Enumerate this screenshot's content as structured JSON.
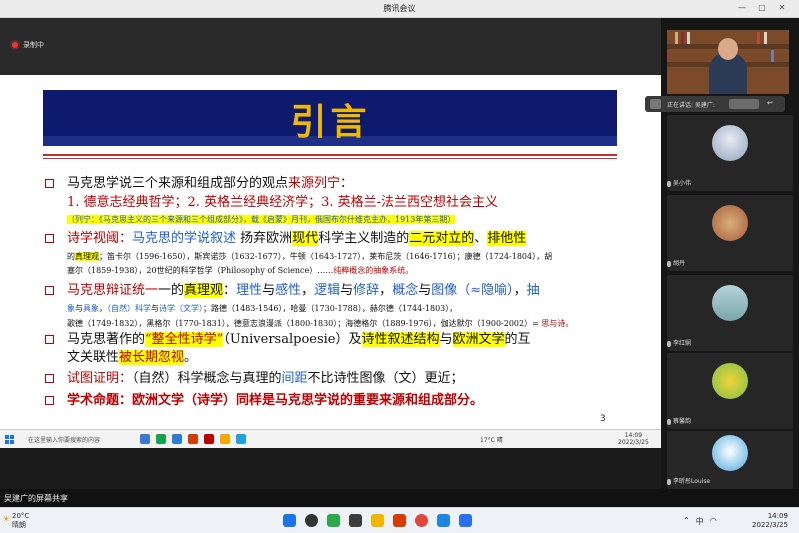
{
  "window": {
    "title": "腾讯会议",
    "controls": [
      "—",
      "▢",
      "✕"
    ]
  },
  "recording": {
    "label": "录制中"
  },
  "slide": {
    "title": "引言",
    "page_number": "3",
    "lines": [
      {
        "parts": [
          {
            "t": "马克思学说三个来源和组成部分的观点"
          },
          {
            "t": "来源列宁",
            "c": "red"
          },
          {
            "t": "："
          }
        ]
      },
      {
        "parts": [
          {
            "t": "1. 德意志经典哲学；2. 英格兰经典经济学；3. 英格兰-法兰西空想社会主义",
            "c": "red"
          }
        ]
      },
      {
        "parts": [
          {
            "t": "（列宁：《马克思主义的三个来源和三个组成部分》，载《启蒙》月刊，俄国布尔什维克主办，1913年第三期）",
            "c": "blue",
            "hl": true
          }
        ]
      },
      {
        "parts": [
          {
            "t": "诗学视阈：",
            "c": "red"
          },
          {
            "t": "马克思的学说叙述",
            "c": "blue"
          },
          {
            "t": " 扬弃欧洲"
          },
          {
            "t": "现代",
            "hl": true
          },
          {
            "t": "科学主义制造的"
          },
          {
            "t": "二元对立的",
            "hl": true
          },
          {
            "t": "、"
          },
          {
            "t": "排他性",
            "hl": true
          }
        ]
      },
      {
        "parts": [
          {
            "t": "的"
          },
          {
            "t": "真理观",
            "hl": true
          },
          {
            "t": "；笛卡尔（1596-1650），斯宾诺莎（1632-1677），牛顿（1643-1727），莱布尼茨（1646-1716）；康德（1724-1804），胡"
          }
        ]
      },
      {
        "parts": [
          {
            "t": "塞尔（1859-1938），20世纪的科学哲学（Philosophy of Science）……"
          },
          {
            "t": "纯粹概念的抽象系统。",
            "c": "red"
          }
        ]
      },
      {
        "parts": [
          {
            "t": "马克思辩证统一",
            "c": "red"
          },
          {
            "t": "一的"
          },
          {
            "t": "真理观",
            "hl": true
          },
          {
            "t": "："
          },
          {
            "t": "理性",
            "c": "blue"
          },
          {
            "t": "与"
          },
          {
            "t": "感性",
            "c": "blue"
          },
          {
            "t": "，"
          },
          {
            "t": "逻辑",
            "c": "blue"
          },
          {
            "t": "与"
          },
          {
            "t": "修辞",
            "c": "blue"
          },
          {
            "t": "，"
          },
          {
            "t": "概念",
            "c": "blue"
          },
          {
            "t": "与"
          },
          {
            "t": "图像（≈隐喻）",
            "c": "blue"
          },
          {
            "t": "，"
          },
          {
            "t": "抽",
            "c": "blue"
          }
        ]
      },
      {
        "parts": [
          {
            "t": "象",
            "c": "blue"
          },
          {
            "t": "与"
          },
          {
            "t": "具象",
            "c": "blue"
          },
          {
            "t": "，"
          },
          {
            "t": "（自然）科学",
            "c": "blue"
          },
          {
            "t": "与"
          },
          {
            "t": "诗学（文学）",
            "c": "blue"
          },
          {
            "t": "；路德（1483-1546），哈曼（1730-1788），赫尔德（1744-1803），"
          }
        ]
      },
      {
        "parts": [
          {
            "t": "歌德（1749-1832），黑格尔（1770-1831），德意志浪漫派（1800-1830）；海德格尔（1889-1976），伽达默尔（1900-2002）= "
          },
          {
            "t": "思与诗。",
            "c": "red"
          }
        ]
      },
      {
        "parts": [
          {
            "t": "马克思著作的"
          },
          {
            "t": "“整全性诗学”",
            "c": "red",
            "hl": true
          },
          {
            "t": "（Universalpoesie）及"
          },
          {
            "t": "诗性叙述结构",
            "hl": true
          },
          {
            "t": "与"
          },
          {
            "t": "欧洲文学",
            "hl": true
          },
          {
            "t": "的互"
          }
        ]
      },
      {
        "parts": [
          {
            "t": "文关联性"
          },
          {
            "t": "被长期忽视",
            "c": "red",
            "hl": true
          },
          {
            "t": "。"
          }
        ]
      },
      {
        "parts": [
          {
            "t": "试图证明：",
            "c": "red"
          },
          {
            "t": "（自然）科学概念与真理的"
          },
          {
            "t": "间距",
            "c": "blue"
          },
          {
            "t": "不比诗性图像（文）更近；"
          }
        ]
      },
      {
        "parts": [
          {
            "t": "学术命题：",
            "c": "red",
            "b": true
          },
          {
            "t": "欧洲文学（诗学）同样是马克思学说的重要来源和组成部分。",
            "c": "red",
            "b": true
          }
        ]
      }
    ]
  },
  "inner_taskbar": {
    "search_placeholder": "在这里输入你要搜索的内容",
    "weather": "17°C 晴",
    "time": "14:09",
    "date": "2022/3/25"
  },
  "participants": {
    "speaking_label": "正在讲话: 吴建广:",
    "tiles": [
      {
        "name": "吴小伟"
      },
      {
        "name": "胡丹"
      },
      {
        "name": "李红娴"
      },
      {
        "name": "蔡馨韵"
      },
      {
        "name": "李昕彤Louise"
      }
    ]
  },
  "share_bar": {
    "label": "吴建广的屏幕共享"
  },
  "taskbar": {
    "weather_temp": "20°C",
    "weather_desc": "晴朗",
    "time": "14:09",
    "date": "2022/3/25",
    "ime": "中"
  },
  "colors": {
    "accent_red": "#c00000",
    "accent_blue": "#1f5fd0",
    "banner": "#0d1a6e",
    "title_gold": "#f0b800"
  }
}
